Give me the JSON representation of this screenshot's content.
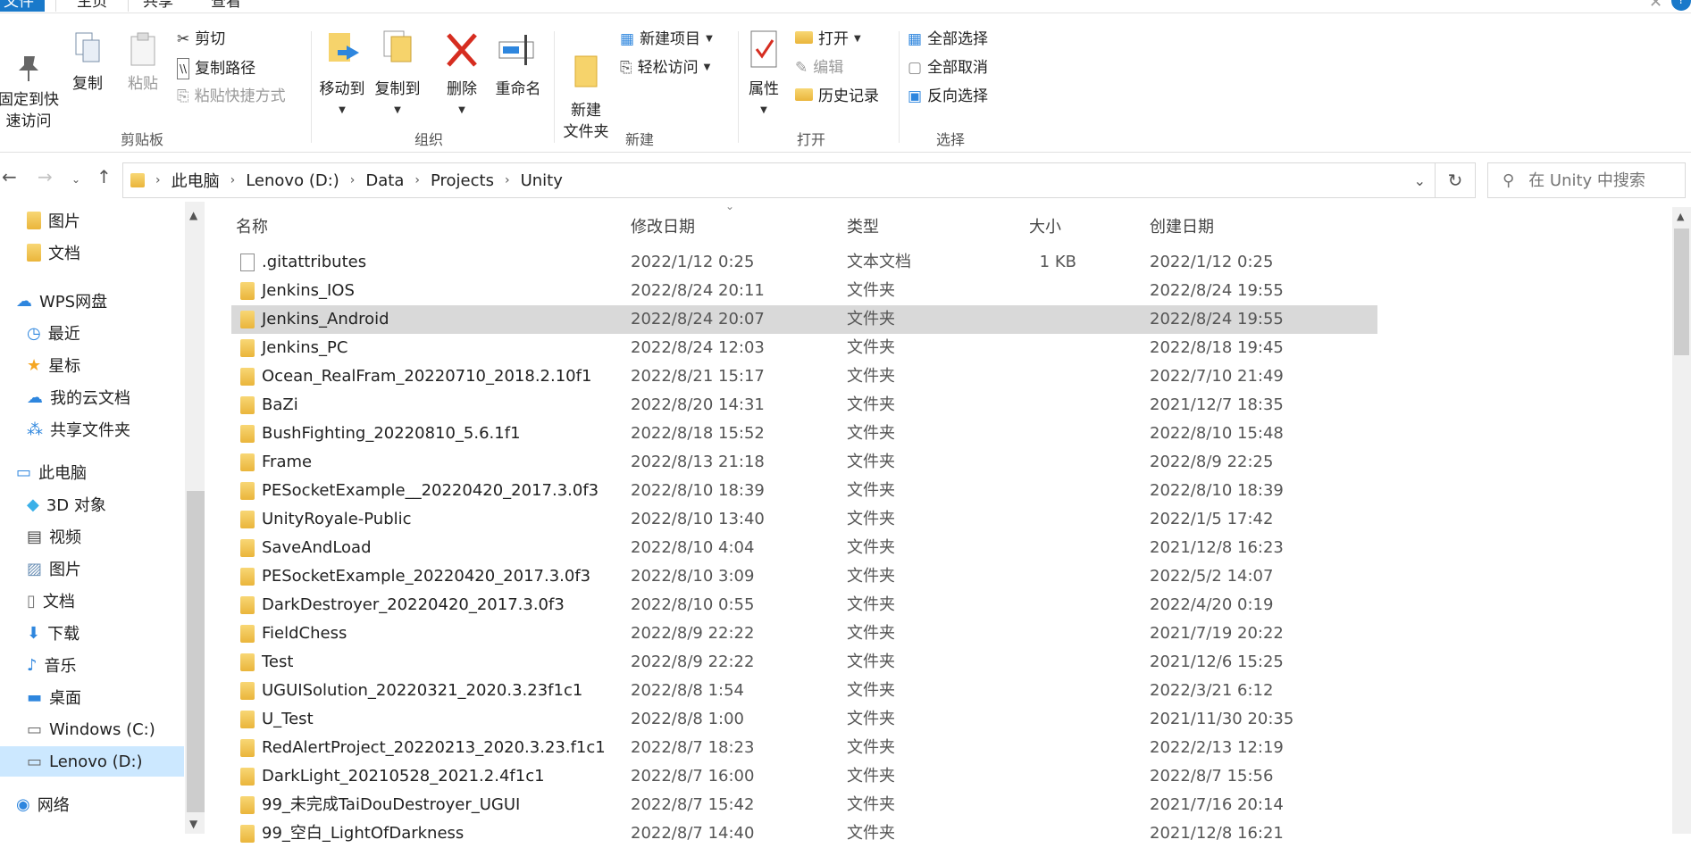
{
  "tabs": {
    "file": "文件",
    "home": "主页",
    "share": "共享",
    "view": "查看"
  },
  "ribbon": {
    "pin": "固定到快\n速访问",
    "copy": "复制",
    "paste": "粘贴",
    "cut": "剪切",
    "copy_path": "复制路径",
    "paste_shortcut": "粘贴快捷方式",
    "move_to": "移动到",
    "copy_to": "复制到",
    "delete": "删除",
    "rename": "重命名",
    "new_folder": "新建\n文件夹",
    "new_item": "新建项目",
    "easy_access": "轻松访问",
    "properties": "属性",
    "open": "打开",
    "edit": "编辑",
    "history": "历史记录",
    "select_all": "全部选择",
    "select_none": "全部取消",
    "invert": "反向选择",
    "groups": {
      "clipboard": "剪贴板",
      "organize": "组织",
      "new": "新建",
      "open": "打开",
      "select": "选择"
    }
  },
  "address": {
    "crumbs": [
      "此电脑",
      "Lenovo (D:)",
      "Data",
      "Projects",
      "Unity"
    ],
    "search_placeholder": "在 Unity 中搜索"
  },
  "nav": [
    {
      "label": "图片",
      "icon": "folder-icon"
    },
    {
      "label": "文档",
      "icon": "folder-icon"
    },
    {
      "label": "WPS网盘",
      "icon": "cloud-icon"
    },
    {
      "label": "最近",
      "icon": "clock-icon"
    },
    {
      "label": "星标",
      "icon": "star-icon"
    },
    {
      "label": "我的云文档",
      "icon": "cloud-icon"
    },
    {
      "label": "共享文件夹",
      "icon": "share-icon"
    },
    {
      "label": "此电脑",
      "icon": "computer-icon"
    },
    {
      "label": "3D 对象",
      "icon": "cube-icon"
    },
    {
      "label": "视频",
      "icon": "video-icon"
    },
    {
      "label": "图片",
      "icon": "picture-icon"
    },
    {
      "label": "文档",
      "icon": "document-icon"
    },
    {
      "label": "下载",
      "icon": "download-icon"
    },
    {
      "label": "音乐",
      "icon": "music-icon"
    },
    {
      "label": "桌面",
      "icon": "desktop-icon"
    },
    {
      "label": "Windows (C:)",
      "icon": "drive-icon"
    },
    {
      "label": "Lenovo (D:)",
      "icon": "drive-icon"
    },
    {
      "label": "网络",
      "icon": "network-icon"
    }
  ],
  "columns": {
    "name": "名称",
    "modified": "修改日期",
    "type": "类型",
    "size": "大小",
    "created": "创建日期"
  },
  "files": [
    {
      "name": ".gitattributes",
      "modified": "2022/1/12 0:25",
      "type": "文本文档",
      "size": "1 KB",
      "created": "2022/1/12 0:25",
      "kind": "file"
    },
    {
      "name": "Jenkins_IOS",
      "modified": "2022/8/24 20:11",
      "type": "文件夹",
      "size": "",
      "created": "2022/8/24 19:55",
      "kind": "folder"
    },
    {
      "name": "Jenkins_Android",
      "modified": "2022/8/24 20:07",
      "type": "文件夹",
      "size": "",
      "created": "2022/8/24 19:55",
      "kind": "folder"
    },
    {
      "name": "Jenkins_PC",
      "modified": "2022/8/24 12:03",
      "type": "文件夹",
      "size": "",
      "created": "2022/8/18 19:45",
      "kind": "folder"
    },
    {
      "name": "Ocean_RealFram_20220710_2018.2.10f1",
      "modified": "2022/8/21 15:17",
      "type": "文件夹",
      "size": "",
      "created": "2022/7/10 21:49",
      "kind": "folder"
    },
    {
      "name": "BaZi",
      "modified": "2022/8/20 14:31",
      "type": "文件夹",
      "size": "",
      "created": "2021/12/7 18:35",
      "kind": "folder"
    },
    {
      "name": "BushFighting_20220810_5.6.1f1",
      "modified": "2022/8/18 15:52",
      "type": "文件夹",
      "size": "",
      "created": "2022/8/10 15:48",
      "kind": "folder"
    },
    {
      "name": "Frame",
      "modified": "2022/8/13 21:18",
      "type": "文件夹",
      "size": "",
      "created": "2022/8/9 22:25",
      "kind": "folder"
    },
    {
      "name": "PESocketExample__20220420_2017.3.0f3",
      "modified": "2022/8/10 18:39",
      "type": "文件夹",
      "size": "",
      "created": "2022/8/10 18:39",
      "kind": "folder"
    },
    {
      "name": "UnityRoyale-Public",
      "modified": "2022/8/10 13:40",
      "type": "文件夹",
      "size": "",
      "created": "2022/1/5 17:42",
      "kind": "folder"
    },
    {
      "name": "SaveAndLoad",
      "modified": "2022/8/10 4:04",
      "type": "文件夹",
      "size": "",
      "created": "2021/12/8 16:23",
      "kind": "folder"
    },
    {
      "name": "PESocketExample_20220420_2017.3.0f3",
      "modified": "2022/8/10 3:09",
      "type": "文件夹",
      "size": "",
      "created": "2022/5/2 14:07",
      "kind": "folder"
    },
    {
      "name": "DarkDestroyer_20220420_2017.3.0f3",
      "modified": "2022/8/10 0:55",
      "type": "文件夹",
      "size": "",
      "created": "2022/4/20 0:19",
      "kind": "folder"
    },
    {
      "name": "FieldChess",
      "modified": "2022/8/9 22:22",
      "type": "文件夹",
      "size": "",
      "created": "2021/7/19 20:22",
      "kind": "folder"
    },
    {
      "name": "Test",
      "modified": "2022/8/9 22:22",
      "type": "文件夹",
      "size": "",
      "created": "2021/12/6 15:25",
      "kind": "folder"
    },
    {
      "name": "UGUISolution_20220321_2020.3.23f1c1",
      "modified": "2022/8/8 1:54",
      "type": "文件夹",
      "size": "",
      "created": "2022/3/21 6:12",
      "kind": "folder"
    },
    {
      "name": "U_Test",
      "modified": "2022/8/8 1:00",
      "type": "文件夹",
      "size": "",
      "created": "2021/11/30 20:35",
      "kind": "folder"
    },
    {
      "name": "RedAlertProject_20220213_2020.3.23.f1c1",
      "modified": "2022/8/7 18:23",
      "type": "文件夹",
      "size": "",
      "created": "2022/2/13 12:19",
      "kind": "folder"
    },
    {
      "name": "DarkLight_20210528_2021.2.4f1c1",
      "modified": "2022/8/7 16:00",
      "type": "文件夹",
      "size": "",
      "created": "2022/8/7 15:56",
      "kind": "folder"
    },
    {
      "name": "99_未完成TaiDouDestroyer_UGUI",
      "modified": "2022/8/7 15:42",
      "type": "文件夹",
      "size": "",
      "created": "2021/7/16 20:14",
      "kind": "folder"
    },
    {
      "name": "99_空白_LightOfDarkness",
      "modified": "2022/8/7 14:40",
      "type": "文件夹",
      "size": "",
      "created": "2021/12/8 16:21",
      "kind": "folder"
    }
  ],
  "selected_file": "Jenkins_Android"
}
